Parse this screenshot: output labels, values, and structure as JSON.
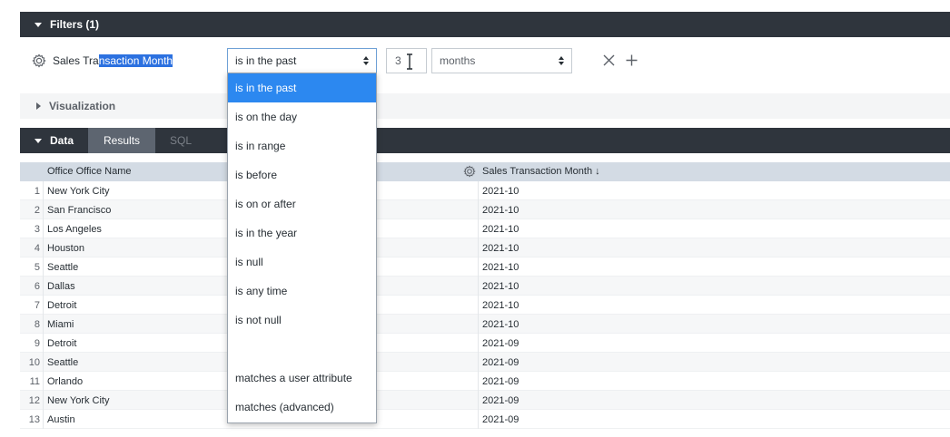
{
  "filters": {
    "header": "Filters (1)",
    "field_label_plain": "Sales Tra",
    "field_label_selected": "nsaction Month",
    "operator_value": "is in the past",
    "number_value": "3",
    "unit_value": "months"
  },
  "visualization": {
    "header": "Visualization"
  },
  "data_section": {
    "header": "Data",
    "tabs": [
      {
        "label": "Results"
      },
      {
        "label": "SQL"
      }
    ]
  },
  "grid": {
    "columns": [
      "Office Office Name",
      "Sales Transaction Month ↓"
    ],
    "rows": [
      {
        "n": "1",
        "office": "New York City",
        "month": "2021-10"
      },
      {
        "n": "2",
        "office": "San Francisco",
        "month": "2021-10"
      },
      {
        "n": "3",
        "office": "Los Angeles",
        "month": "2021-10"
      },
      {
        "n": "4",
        "office": "Houston",
        "month": "2021-10"
      },
      {
        "n": "5",
        "office": "Seattle",
        "month": "2021-10"
      },
      {
        "n": "6",
        "office": "Dallas",
        "month": "2021-10"
      },
      {
        "n": "7",
        "office": "Detroit",
        "month": "2021-10"
      },
      {
        "n": "8",
        "office": "Miami",
        "month": "2021-10"
      },
      {
        "n": "9",
        "office": "Detroit",
        "month": "2021-09"
      },
      {
        "n": "10",
        "office": "Seattle",
        "month": "2021-09"
      },
      {
        "n": "11",
        "office": "Orlando",
        "month": "2021-09"
      },
      {
        "n": "12",
        "office": "New York City",
        "month": "2021-09"
      },
      {
        "n": "13",
        "office": "Austin",
        "month": "2021-09"
      }
    ]
  },
  "dropdown": {
    "items": [
      {
        "label": "is in the past",
        "active": true
      },
      {
        "label": "is on the day"
      },
      {
        "label": "is in range"
      },
      {
        "label": "is before"
      },
      {
        "label": "is on or after"
      },
      {
        "label": "is in the year"
      },
      {
        "label": "is null"
      },
      {
        "label": "is any time"
      },
      {
        "label": "is not null"
      },
      {
        "label": ""
      },
      {
        "label": "matches a user attribute"
      },
      {
        "label": "matches (advanced)"
      }
    ]
  },
  "colors": {
    "section_bar": "#2f353d",
    "highlight": "#2c88f0",
    "grid_header": "#d3dbe4"
  }
}
